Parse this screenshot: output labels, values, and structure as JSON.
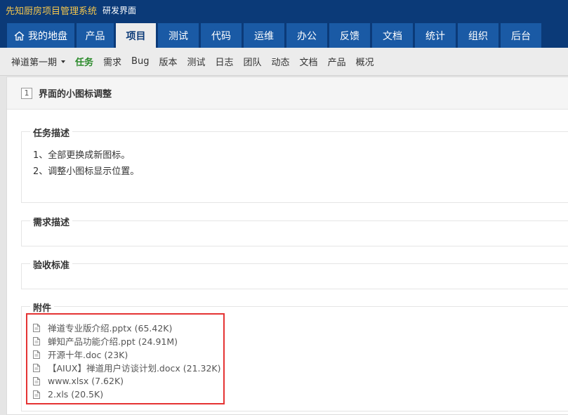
{
  "app": {
    "name": "先知厨房项目管理系统",
    "subtitle": "研发界面"
  },
  "main_nav": [
    {
      "label": "我的地盘",
      "icon": "home-icon",
      "active": false
    },
    {
      "label": "产品",
      "active": false
    },
    {
      "label": "项目",
      "active": true
    },
    {
      "label": "测试",
      "active": false
    },
    {
      "label": "代码",
      "active": false
    },
    {
      "label": "运维",
      "active": false
    },
    {
      "label": "办公",
      "active": false
    },
    {
      "label": "反馈",
      "active": false
    },
    {
      "label": "文档",
      "active": false
    },
    {
      "label": "统计",
      "active": false
    },
    {
      "label": "组织",
      "active": false
    },
    {
      "label": "后台",
      "active": false
    }
  ],
  "sub_nav": {
    "project": "禅道第一期",
    "items": [
      {
        "label": "任务",
        "active": true
      },
      {
        "label": "需求",
        "active": false
      },
      {
        "label": "Bug",
        "active": false
      },
      {
        "label": "版本",
        "active": false
      },
      {
        "label": "测试",
        "active": false
      },
      {
        "label": "日志",
        "active": false
      },
      {
        "label": "团队",
        "active": false
      },
      {
        "label": "动态",
        "active": false
      },
      {
        "label": "文档",
        "active": false
      },
      {
        "label": "产品",
        "active": false
      },
      {
        "label": "概况",
        "active": false
      }
    ]
  },
  "task": {
    "id": "1",
    "title": "界面的小图标调整"
  },
  "sections": {
    "task_desc": {
      "title": "任务描述",
      "lines": [
        "1、全部更换成新图标。",
        "2、调整小图标显示位置。"
      ]
    },
    "story_desc": {
      "title": "需求描述"
    },
    "verify": {
      "title": "验收标准"
    },
    "attachments": {
      "title": "附件",
      "files": [
        "禅道专业版介绍.pptx (65.42K)",
        "蝉知产品功能介绍.ppt (24.91M)",
        "开源十年.doc (23K)",
        "【AIUX】禅道用户访谈计划.docx (21.32K)",
        "www.xlsx (7.62K)",
        "2.xls (20.5K)"
      ]
    }
  },
  "colors": {
    "header_bg": "#0b3a78",
    "nav_item_bg": "#1a5aa5",
    "brand_text": "#f4c64d",
    "active_sub": "#2b8a2b",
    "highlight": "#e53333"
  }
}
